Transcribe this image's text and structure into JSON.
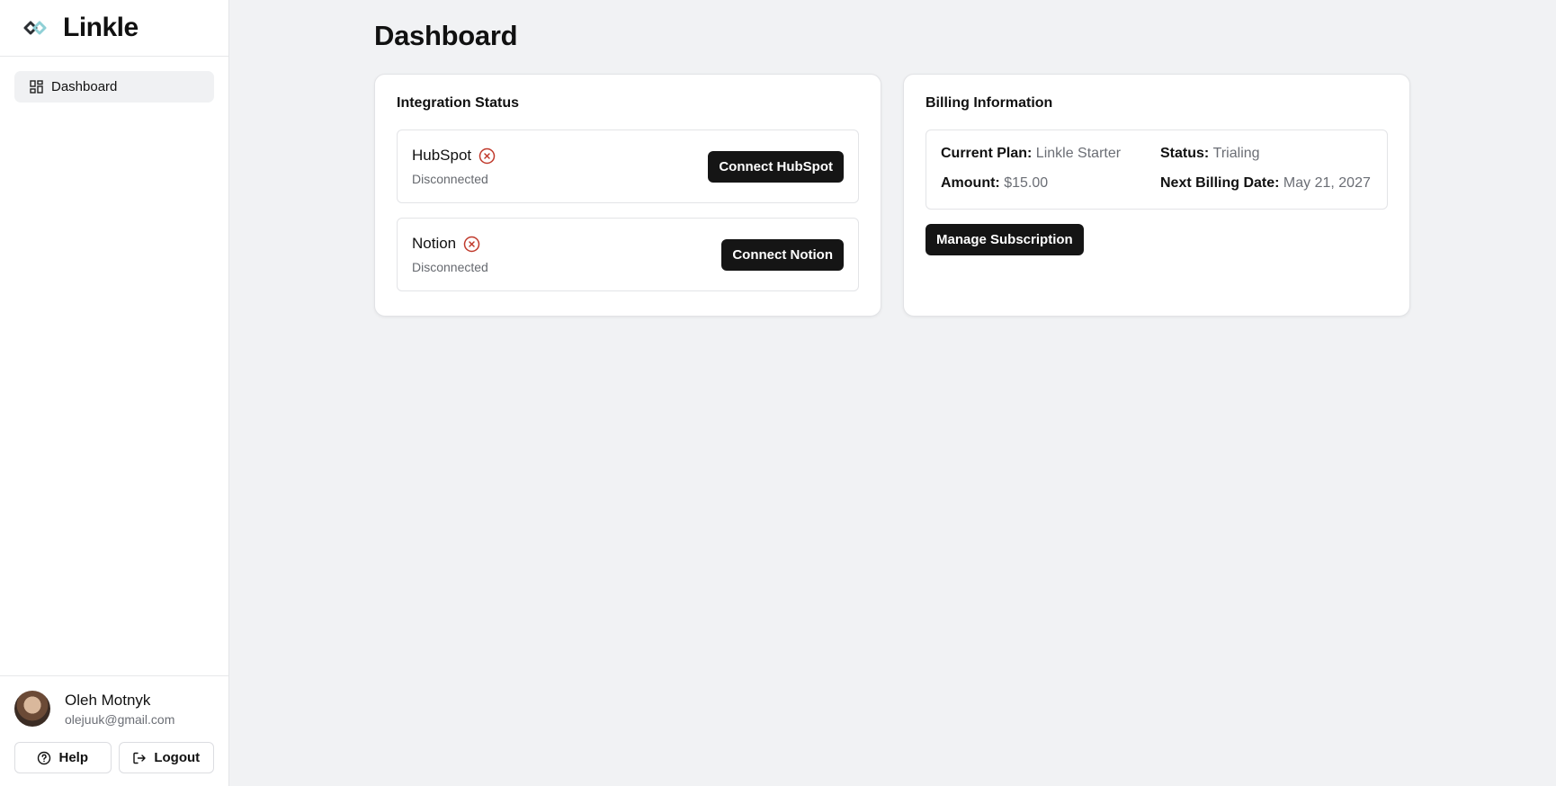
{
  "brand": {
    "name": "Linkle",
    "logo_icon": "linkle-logo-icon"
  },
  "sidebar": {
    "nav": [
      {
        "label": "Dashboard",
        "icon": "dashboard-grid-icon",
        "active": true
      }
    ]
  },
  "user": {
    "name": "Oleh Motnyk",
    "email": "olejuuk@gmail.com",
    "help_label": "Help",
    "logout_label": "Logout"
  },
  "main": {
    "title": "Dashboard"
  },
  "integrations": {
    "title": "Integration Status",
    "items": [
      {
        "name": "HubSpot",
        "status": "Disconnected",
        "button": "Connect HubSpot",
        "status_icon": "x-circle-icon"
      },
      {
        "name": "Notion",
        "status": "Disconnected",
        "button": "Connect Notion",
        "status_icon": "x-circle-icon"
      }
    ]
  },
  "billing": {
    "title": "Billing Information",
    "plan_label": "Current Plan:",
    "plan_value": "Linkle Starter",
    "status_label": "Status:",
    "status_value": "Trialing",
    "amount_label": "Amount:",
    "amount_value": "$15.00",
    "next_label": "Next Billing Date:",
    "next_value": "May 21, 2027",
    "manage_button": "Manage Subscription"
  },
  "colors": {
    "accent_dark": "#151515",
    "error_red": "#c0392b",
    "muted_text": "#6b6e75",
    "page_bg": "#f1f2f4"
  }
}
